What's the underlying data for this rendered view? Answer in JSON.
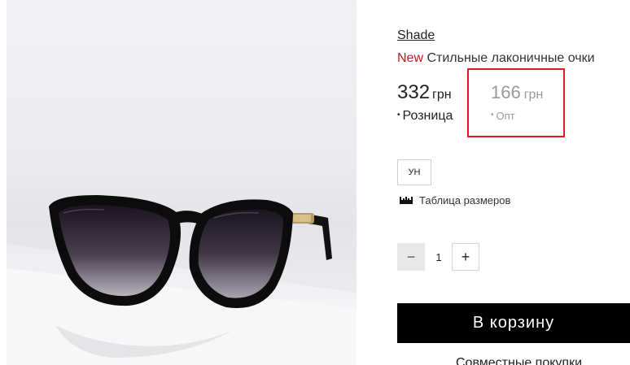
{
  "product": {
    "brand": "Shade",
    "badge": "New",
    "title": "Стильные лаконичные очки",
    "image_alt_icon": "sunglasses-photo"
  },
  "prices": {
    "retail": {
      "value": "332",
      "currency": "грн",
      "label": "Розница"
    },
    "wholesale": {
      "value": "166",
      "currency": "грн",
      "label": "Опт"
    },
    "bullet": "•"
  },
  "sizes": {
    "options": [
      "УН"
    ],
    "size_table_label": "Таблица размеров",
    "size_table_icon": "ruler-icon"
  },
  "quantity": {
    "minus": "−",
    "value": "1",
    "plus": "+"
  },
  "actions": {
    "cart_label": "В корзину",
    "joint_purchase_label": "Совместные покупки"
  },
  "colors": {
    "badge_red": "#d0141c",
    "highlight_red": "#e01b23",
    "button_black": "#000000",
    "muted_gray": "#9a9a9a"
  }
}
